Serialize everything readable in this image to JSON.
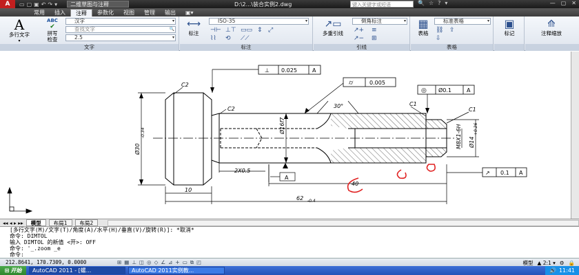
{
  "titlebar": {
    "logo": "A",
    "workspace": "二维草图与注释",
    "document_title": "D:\\2...\\装合实例2.dwg",
    "search_placeholder": "键入关键字或短语",
    "quick_access": [
      "▭",
      "▢",
      "▣",
      "↶",
      "↷",
      "▾"
    ],
    "right_icons": [
      "🔍",
      "☆",
      "?",
      "▾"
    ],
    "window_buttons": [
      "—",
      "▢",
      "✕"
    ]
  },
  "ribbon_tabs": [
    "常用",
    "插入",
    "注释",
    "参数化",
    "视图",
    "管理",
    "输出",
    "▣▾"
  ],
  "ribbon_active_tab": "注释",
  "ribbon": {
    "text_group": {
      "title": "文字",
      "mtext_label": "多行文字",
      "spell_label": "拼写\n检查",
      "spell_icon_text": "ABC",
      "text_style": "汉字",
      "find_text": "查找文字",
      "text_height": "2.5"
    },
    "dim_group": {
      "title": "标注",
      "dim_label": "标注",
      "dim_style": "ISO-35"
    },
    "leader_group": {
      "title": "引线",
      "multileader_label": "多重引线",
      "leader_style": "倒角标注"
    },
    "table_group": {
      "title": "表格",
      "table_label": "表格",
      "table_style": "标准表格"
    },
    "mark_group": {
      "mark_label": "标记"
    },
    "scale_group": {
      "scale_label": "注释缩放"
    }
  },
  "drawing": {
    "annotations": {
      "flatness_tol": "0.025",
      "flatness_datum": "A",
      "cyl_tol": "0.005",
      "conc_tol": "Ø0.1",
      "conc_datum": "A",
      "runout_tol": "0.1",
      "runout_datum": "A",
      "chamfer_c2_left": "C2",
      "chamfer_c2_mid": "C2",
      "chamfer_c1_top": "C1",
      "chamfer_c1_right": "C1",
      "angle": "30°",
      "dia_16f7": "Ø16f7",
      "dia_30": "Ø30",
      "dia_30_tol": "-0.34",
      "dia_14": "Ø14",
      "dia_14_tol": "+0.26",
      "thread": "M8X1-6H",
      "chamfer_2x05": "2X0.5",
      "datum_a": "A",
      "len_10": "10",
      "len_40": "40",
      "len_62": "62",
      "len_62_tol": "-0.4"
    }
  },
  "layout_tabs": [
    "模型",
    "布局1",
    "布局2"
  ],
  "command_lines": [
    "[多行文字(M)/文字(T)/角度(A)/水平(H)/垂直(V)/旋转(R)]: *取消*",
    "命令: DIMTOL",
    "输入 DIMTOL 的新值 <开>: OFF",
    "命令: '_.zoom _e"
  ],
  "command_prompt": "命令:",
  "status": {
    "coords": "212.8641, 170.7309, 0.0000",
    "model_label": "模型",
    "scale": "▲ 2:1 ▾",
    "icons": [
      "⊞",
      "▦",
      "⊥",
      "◫",
      "◎",
      "◇",
      "∠",
      "⊿",
      "+",
      "▭",
      "⧉",
      "◰"
    ]
  },
  "taskbar": {
    "start_label": "开始",
    "tasks": [
      "AutoCAD 2011 - [螺...",
      "AutoCAD 2011实例教..."
    ],
    "clock": "11:41"
  },
  "colors": {
    "titlebar": "#2a2a2a",
    "ribbon_bg": "#e6ecf3",
    "annotation_red": "#e02020",
    "taskbar": "#2453b8",
    "start_button": "#3a9a3a"
  }
}
